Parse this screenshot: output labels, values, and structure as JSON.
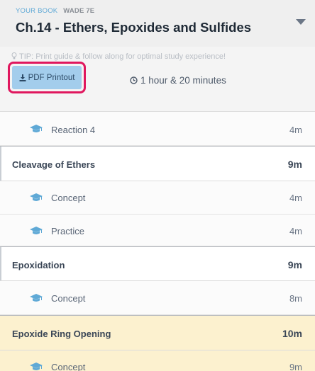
{
  "header": {
    "book_label": "YOUR BOOK",
    "book_name": "WADE 7E",
    "chapter_title": "Ch.14 - Ethers, Epoxides and Sulfides"
  },
  "toolbar": {
    "tip_text": "TIP: Print guide & follow along for optimal study experience!",
    "pdf_button_label": "PDF Printout",
    "total_duration": "1 hour & 20 minutes"
  },
  "outline": {
    "rows": [
      {
        "kind": "item",
        "label": "Reaction 4",
        "duration": "4m",
        "icon": "graduation-cap-icon"
      },
      {
        "kind": "section",
        "label": "Cleavage of Ethers",
        "duration": "9m"
      },
      {
        "kind": "item",
        "label": "Concept",
        "duration": "4m",
        "icon": "graduation-cap-icon"
      },
      {
        "kind": "item",
        "label": "Practice",
        "duration": "4m",
        "icon": "graduation-cap-icon"
      },
      {
        "kind": "section",
        "label": "Epoxidation",
        "duration": "9m"
      },
      {
        "kind": "item",
        "label": "Concept",
        "duration": "8m",
        "icon": "graduation-cap-icon"
      },
      {
        "kind": "section",
        "label": "Epoxide Ring Opening",
        "duration": "10m",
        "active": true
      },
      {
        "kind": "item",
        "label": "Concept",
        "duration": "9m",
        "icon": "graduation-cap-icon",
        "active": true
      }
    ]
  },
  "colors": {
    "accent_blue": "#5fa9d6",
    "pdf_button_bg": "#a3cdec",
    "highlight_ring": "#e0175e",
    "active_row_bg": "#fcf1cf"
  }
}
